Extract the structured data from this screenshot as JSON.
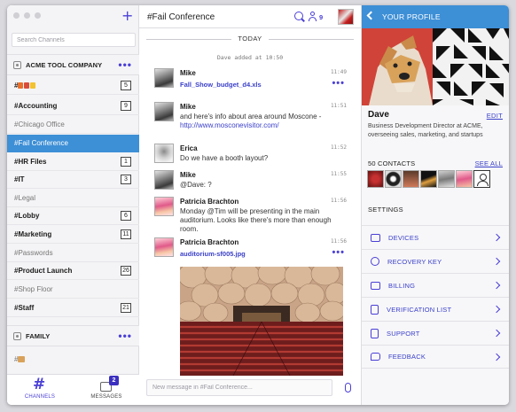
{
  "sidebar": {
    "search_placeholder": "Search Channels",
    "teams": [
      {
        "name": "ACME TOOL COMPANY"
      },
      {
        "name": "FAMILY"
      }
    ],
    "channels": [
      {
        "name": "#",
        "count": "5"
      },
      {
        "name": "#Accounting",
        "count": "9"
      },
      {
        "name": "#Chicago Office"
      },
      {
        "name": "#Fail Conference"
      },
      {
        "name": "#HR Files",
        "count": "1"
      },
      {
        "name": "#IT",
        "count": "3"
      },
      {
        "name": "#Legal"
      },
      {
        "name": "#Lobby",
        "count": "6"
      },
      {
        "name": "#Marketing",
        "count": "11"
      },
      {
        "name": "#Passwords"
      },
      {
        "name": "#Product Launch",
        "count": "26"
      },
      {
        "name": "#Shop Floor"
      },
      {
        "name": "#Staff",
        "count": "21"
      }
    ],
    "family_channel": "#",
    "tabs": {
      "channels": "CHANNELS",
      "messages": "MESSAGES",
      "messages_badge": "2"
    }
  },
  "main": {
    "title": "#Fail Conference",
    "member_count": "9",
    "day": "TODAY",
    "system_message": "Dave added at 10:50",
    "messages": [
      {
        "author": "Mike",
        "time": "11:49",
        "file": "Fall_Show_budget_d4.xls"
      },
      {
        "author": "Mike",
        "time": "11:51",
        "text": "and here's info about area around Moscone -",
        "link": "http://www.mosconevisitor.com/"
      },
      {
        "author": "Erica",
        "time": "11:52",
        "text": "Do we have a booth layout?"
      },
      {
        "author": "Mike",
        "time": "11:55",
        "text": "@Dave: ?"
      },
      {
        "author": "Patricia Brachton",
        "time": "11:56",
        "text": "Monday @Tim will be presenting in the main auditorium.  Looks like there's more than enough room."
      },
      {
        "author": "Patricia Brachton",
        "time": "11:56",
        "file": "auditorium-sf005.jpg"
      }
    ],
    "composer_placeholder": "New message in #Fail Conference..."
  },
  "profile": {
    "header": "YOUR PROFILE",
    "name": "Dave",
    "edit": "EDIT",
    "bio": "Business Development Director at ACME, overseeing sales, marketing, and startups",
    "contacts_label": "50 CONTACTS",
    "see_all": "SEE ALL",
    "settings_label": "SETTINGS",
    "settings": [
      {
        "label": "DEVICES",
        "icon": "devices-icon"
      },
      {
        "label": "RECOVERY KEY",
        "icon": "key-icon"
      },
      {
        "label": "BILLING",
        "icon": "card-icon"
      },
      {
        "label": "VERIFICATION LIST",
        "icon": "id-card-icon"
      },
      {
        "label": "SUPPORT",
        "icon": "support-icon"
      },
      {
        "label": "FEEDBACK",
        "icon": "chat-icon"
      }
    ]
  },
  "colors": {
    "accent": "#4a3fd6",
    "active_channel": "#3d8fd6",
    "link": "#3a3fc9"
  }
}
